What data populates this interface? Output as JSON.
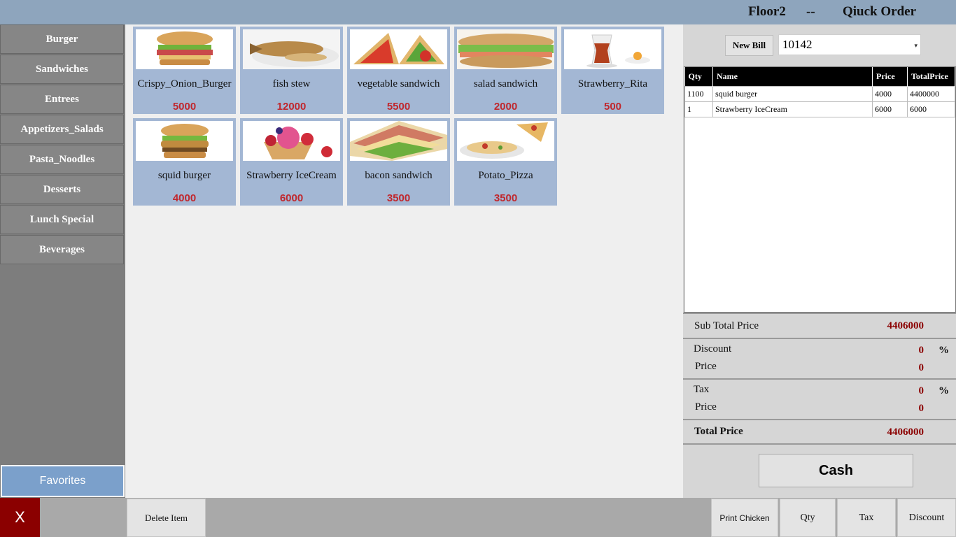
{
  "header": {
    "floor": "Floor2",
    "separator": "--",
    "mode": "Qiuck Order",
    "bg_color": "#8ea5bd"
  },
  "categories": [
    {
      "label": "Burger"
    },
    {
      "label": "Sandwiches"
    },
    {
      "label": "Entrees"
    },
    {
      "label": "Appetizers_Salads"
    },
    {
      "label": "Pasta_Noodles"
    },
    {
      "label": "Desserts"
    },
    {
      "label": "Lunch Special"
    },
    {
      "label": "Beverages"
    }
  ],
  "favorites_label": "Favorites",
  "products": [
    {
      "name": "Crispy_Onion_Burger",
      "price": "5000",
      "image": "burger-photo"
    },
    {
      "name": "fish stew",
      "price": "12000",
      "image": "fish-photo"
    },
    {
      "name": "vegetable sandwich",
      "price": "5500",
      "image": "vegetable-sandwich-photo"
    },
    {
      "name": "salad sandwich",
      "price": "2000",
      "image": "salad-sandwich-photo"
    },
    {
      "name": "Strawberry_Rita",
      "price": "500",
      "image": "tea-glass-photo"
    },
    {
      "name": "squid burger",
      "price": "4000",
      "image": "squid-burger-photo"
    },
    {
      "name": "Strawberry IceCream",
      "price": "6000",
      "image": "ice-cream-photo"
    },
    {
      "name": "bacon sandwich",
      "price": "3500",
      "image": "bacon-sandwich-photo"
    },
    {
      "name": "Potato_Pizza",
      "price": "3500",
      "image": "pizza-photo"
    }
  ],
  "order": {
    "new_bill_label": "New Bill",
    "bill_number": "10142",
    "columns": [
      "Qty",
      "Name",
      "Price",
      "TotalPrice"
    ],
    "rows": [
      {
        "qty": "1100",
        "name": "squid burger",
        "price": "4000",
        "total": "4400000"
      },
      {
        "qty": "1",
        "name": "Strawberry IceCream",
        "price": "6000",
        "total": "6000"
      }
    ]
  },
  "summary": {
    "subtotal_label": "Sub Total Price",
    "subtotal_value": "4406000",
    "discount_label": "Discount",
    "discount_percent": "0",
    "discount_price_label": "Price",
    "discount_price": "0",
    "tax_label": "Tax",
    "tax_percent": "0",
    "tax_price_label": "Price",
    "tax_price": "0",
    "percent_sign": "%",
    "total_label": "Total Price",
    "total_value": "4406000"
  },
  "cash_label": "Cash",
  "bottom": {
    "close_label": "X",
    "delete_item": "Delete Item",
    "print_chicken": "Print Chicken",
    "qty": "Qty",
    "tax": "Tax",
    "discount": "Discount"
  }
}
